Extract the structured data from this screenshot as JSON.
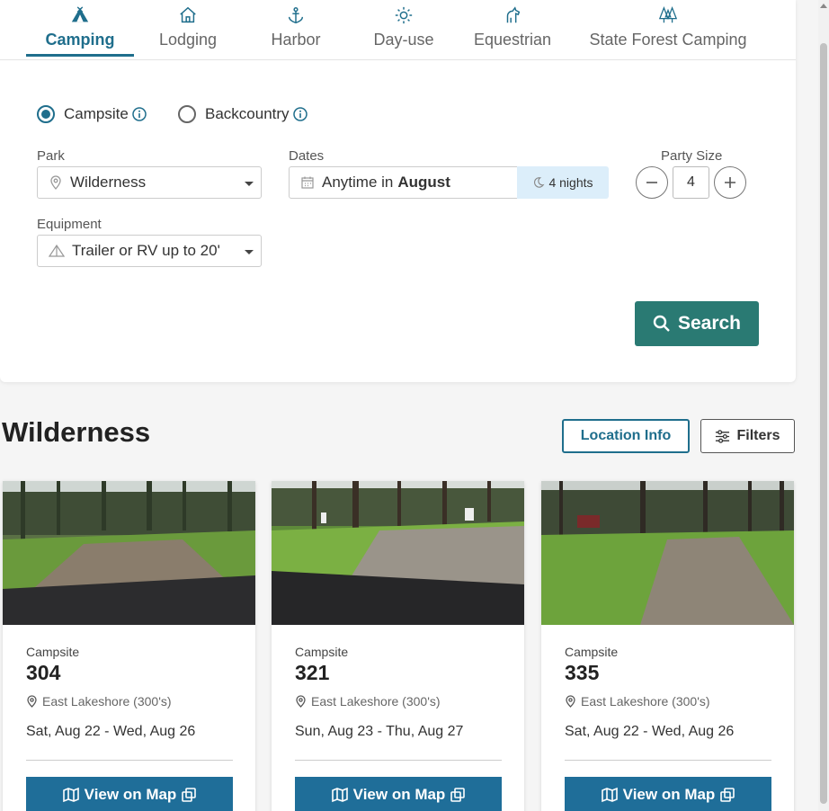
{
  "tabs": [
    {
      "label": "Camping",
      "icon": "tent-icon",
      "active": true
    },
    {
      "label": "Lodging",
      "icon": "house-icon",
      "active": false
    },
    {
      "label": "Harbor",
      "icon": "anchor-icon",
      "active": false
    },
    {
      "label": "Day-use",
      "icon": "sun-icon",
      "active": false
    },
    {
      "label": "Equestrian",
      "icon": "horse-icon",
      "active": false
    },
    {
      "label": "State Forest Camping",
      "icon": "trees-icon",
      "active": false
    }
  ],
  "site_type": {
    "options": [
      {
        "label": "Campsite",
        "selected": true
      },
      {
        "label": "Backcountry",
        "selected": false
      }
    ]
  },
  "park": {
    "label": "Park",
    "value": "Wilderness"
  },
  "dates": {
    "label": "Dates",
    "prefix": "Anytime in",
    "month": "August",
    "nights": "4 nights"
  },
  "party": {
    "label": "Party Size",
    "value": "4"
  },
  "equipment": {
    "label": "Equipment",
    "value": "Trailer or RV up to 20'"
  },
  "search_label": "Search",
  "results": {
    "title": "Wilderness",
    "location_info_label": "Location Info",
    "filters_label": "Filters",
    "view_on_map_label": "View on Map",
    "cards": [
      {
        "type": "Campsite",
        "number": "304",
        "location": "East Lakeshore (300's)",
        "dates": "Sat, Aug 22 - Wed, Aug 26"
      },
      {
        "type": "Campsite",
        "number": "321",
        "location": "East Lakeshore (300's)",
        "dates": "Sun, Aug 23 - Thu, Aug 27"
      },
      {
        "type": "Campsite",
        "number": "335",
        "location": "East Lakeshore (300's)",
        "dates": "Sat, Aug 22 - Wed, Aug 26"
      }
    ]
  },
  "colors": {
    "primary": "#1f6e8c",
    "search_button": "#2a7a73",
    "map_button": "#1f6e99",
    "nights_bg": "#dceefa"
  }
}
